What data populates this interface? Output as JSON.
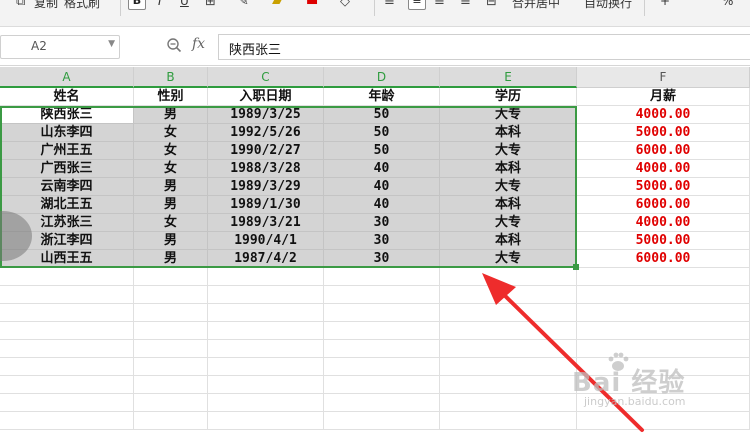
{
  "toolbar": {
    "copy_label": "复制",
    "format_painter_label": "格式刷",
    "bold_label": "B",
    "italic_label": "I",
    "underline_label": "U",
    "merge_center_label": "合并居中",
    "wrap_text_label": "自动换行",
    "percent_label": "%",
    "plus_label": "+"
  },
  "formula_bar": {
    "cell_ref": "A2",
    "fx_label": "fx",
    "content": "陕西张三"
  },
  "columns": [
    "A",
    "B",
    "C",
    "D",
    "E",
    "F"
  ],
  "header_row": [
    "姓名",
    "性别",
    "入职日期",
    "年龄",
    "学历",
    "月薪"
  ],
  "rows": [
    [
      "陕西张三",
      "男",
      "1989/3/25",
      "50",
      "大专",
      "4000.00"
    ],
    [
      "山东李四",
      "女",
      "1992/5/26",
      "50",
      "本科",
      "5000.00"
    ],
    [
      "广州王五",
      "女",
      "1990/2/27",
      "50",
      "大专",
      "6000.00"
    ],
    [
      "广西张三",
      "女",
      "1988/3/28",
      "40",
      "本科",
      "4000.00"
    ],
    [
      "云南李四",
      "男",
      "1989/3/29",
      "40",
      "大专",
      "5000.00"
    ],
    [
      "湖北王五",
      "男",
      "1989/1/30",
      "40",
      "本科",
      "6000.00"
    ],
    [
      "江苏张三",
      "女",
      "1989/3/21",
      "30",
      "大专",
      "4000.00"
    ],
    [
      "浙江李四",
      "男",
      "1990/4/1",
      "30",
      "本科",
      "5000.00"
    ],
    [
      "山西王五",
      "男",
      "1987/4/2",
      "30",
      "大专",
      "6000.00"
    ]
  ],
  "colors": {
    "selection_border": "#3b9a44",
    "salary_text": "#e00000",
    "arrow": "#ee2c2c"
  },
  "watermark": {
    "text": "Bai 经验",
    "sub": "jingyan.baidu.com"
  }
}
